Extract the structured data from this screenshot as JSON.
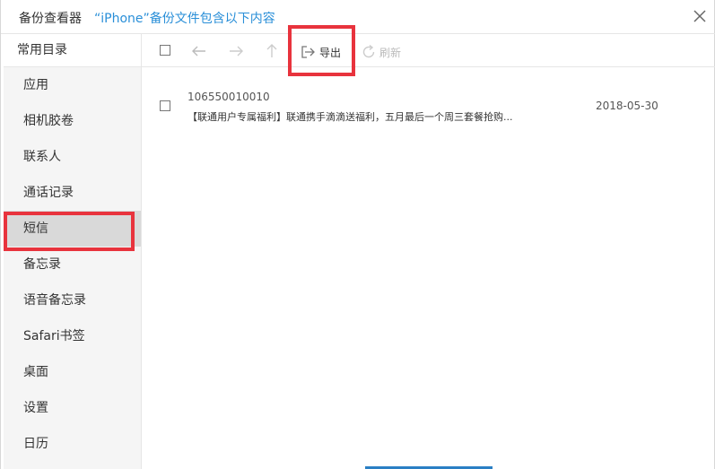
{
  "window": {
    "app_title": "备份查看器",
    "device_title": "“iPhone”备份文件包含以下内容"
  },
  "sidebar": {
    "header": "常用目录",
    "items": [
      {
        "label": "应用"
      },
      {
        "label": "相机胶卷"
      },
      {
        "label": "联系人"
      },
      {
        "label": "通话记录"
      },
      {
        "label": "短信",
        "active": true
      },
      {
        "label": "备忘录"
      },
      {
        "label": "语音备忘录"
      },
      {
        "label": "Safari书签"
      },
      {
        "label": "桌面"
      },
      {
        "label": "设置"
      },
      {
        "label": "日历"
      }
    ]
  },
  "toolbar": {
    "export_label": "导出",
    "refresh_label": "刷新"
  },
  "messages": [
    {
      "sender": "106550010010",
      "preview": "【联通用户专属福利】联通携手滴滴送福利，五月最后一个周三套餐抢购...",
      "date": "2018-05-30"
    }
  ],
  "colors": {
    "accent": "#2a8fd8",
    "highlight": "#e8333d",
    "active_item": "#d9d9d9"
  },
  "icons": [
    "close-icon",
    "back-arrow-icon",
    "forward-arrow-icon",
    "up-arrow-icon",
    "export-icon",
    "refresh-icon"
  ]
}
